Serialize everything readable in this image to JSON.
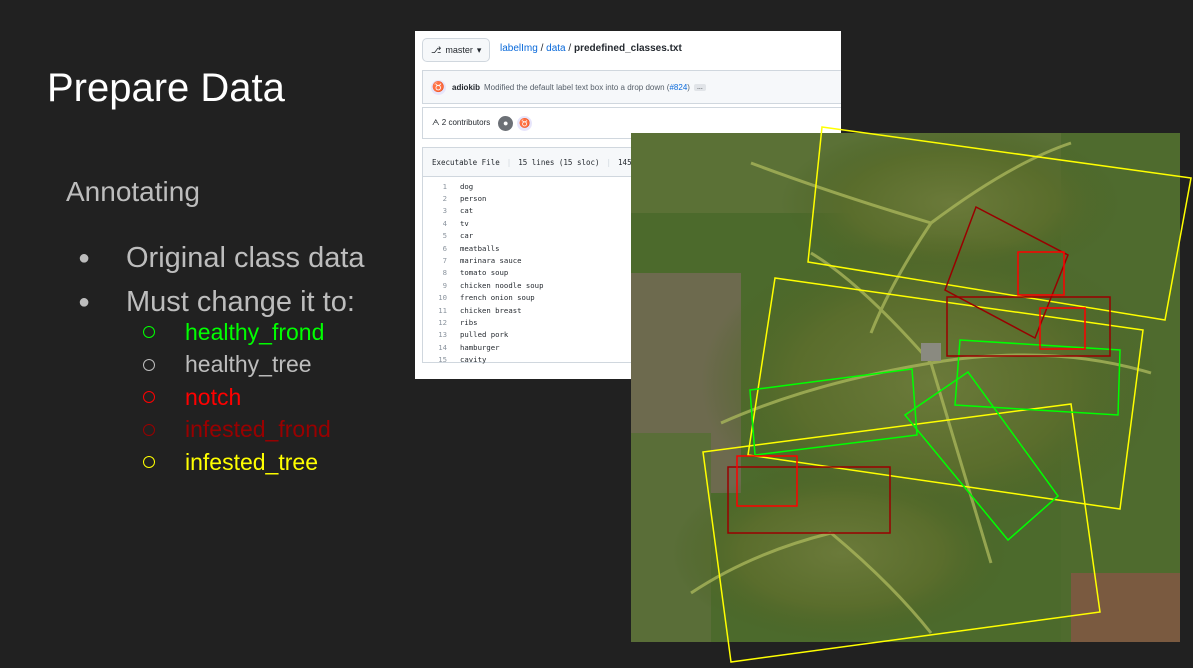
{
  "slide": {
    "title": "Prepare Data",
    "subtitle": "Annotating",
    "bullets": [
      "Original class data",
      "Must change it to:"
    ],
    "classes": [
      {
        "label": "healthy_frond",
        "color": "#00ff00"
      },
      {
        "label": "healthy_tree",
        "color": "#bdbdbd"
      },
      {
        "label": "notch",
        "color": "#ff0000"
      },
      {
        "label": "infested_frond",
        "color": "#990000"
      },
      {
        "label": "infested_tree",
        "color": "#ffff00"
      }
    ]
  },
  "github": {
    "branch": "master",
    "repo": "labelImg",
    "folder": "data",
    "file": "predefined_classes.txt",
    "commit_author": "adiokib",
    "commit_message": "Modified the default label text box into a drop down (",
    "commit_pr": "#824",
    "commit_close": ")",
    "commit_more": "...",
    "contributors": "2 contributors",
    "file_type": "Executable File",
    "file_lines": "15 lines (15 sloc)",
    "file_size": "145 B",
    "lines": [
      "dog",
      "person",
      "cat",
      "tv",
      "car",
      "meatballs",
      "marinara sauce",
      "tomato soup",
      "chicken noodle soup",
      "french onion soup",
      "chicken breast",
      "ribs",
      "pulled pork",
      "hamburger",
      "cavity"
    ]
  }
}
